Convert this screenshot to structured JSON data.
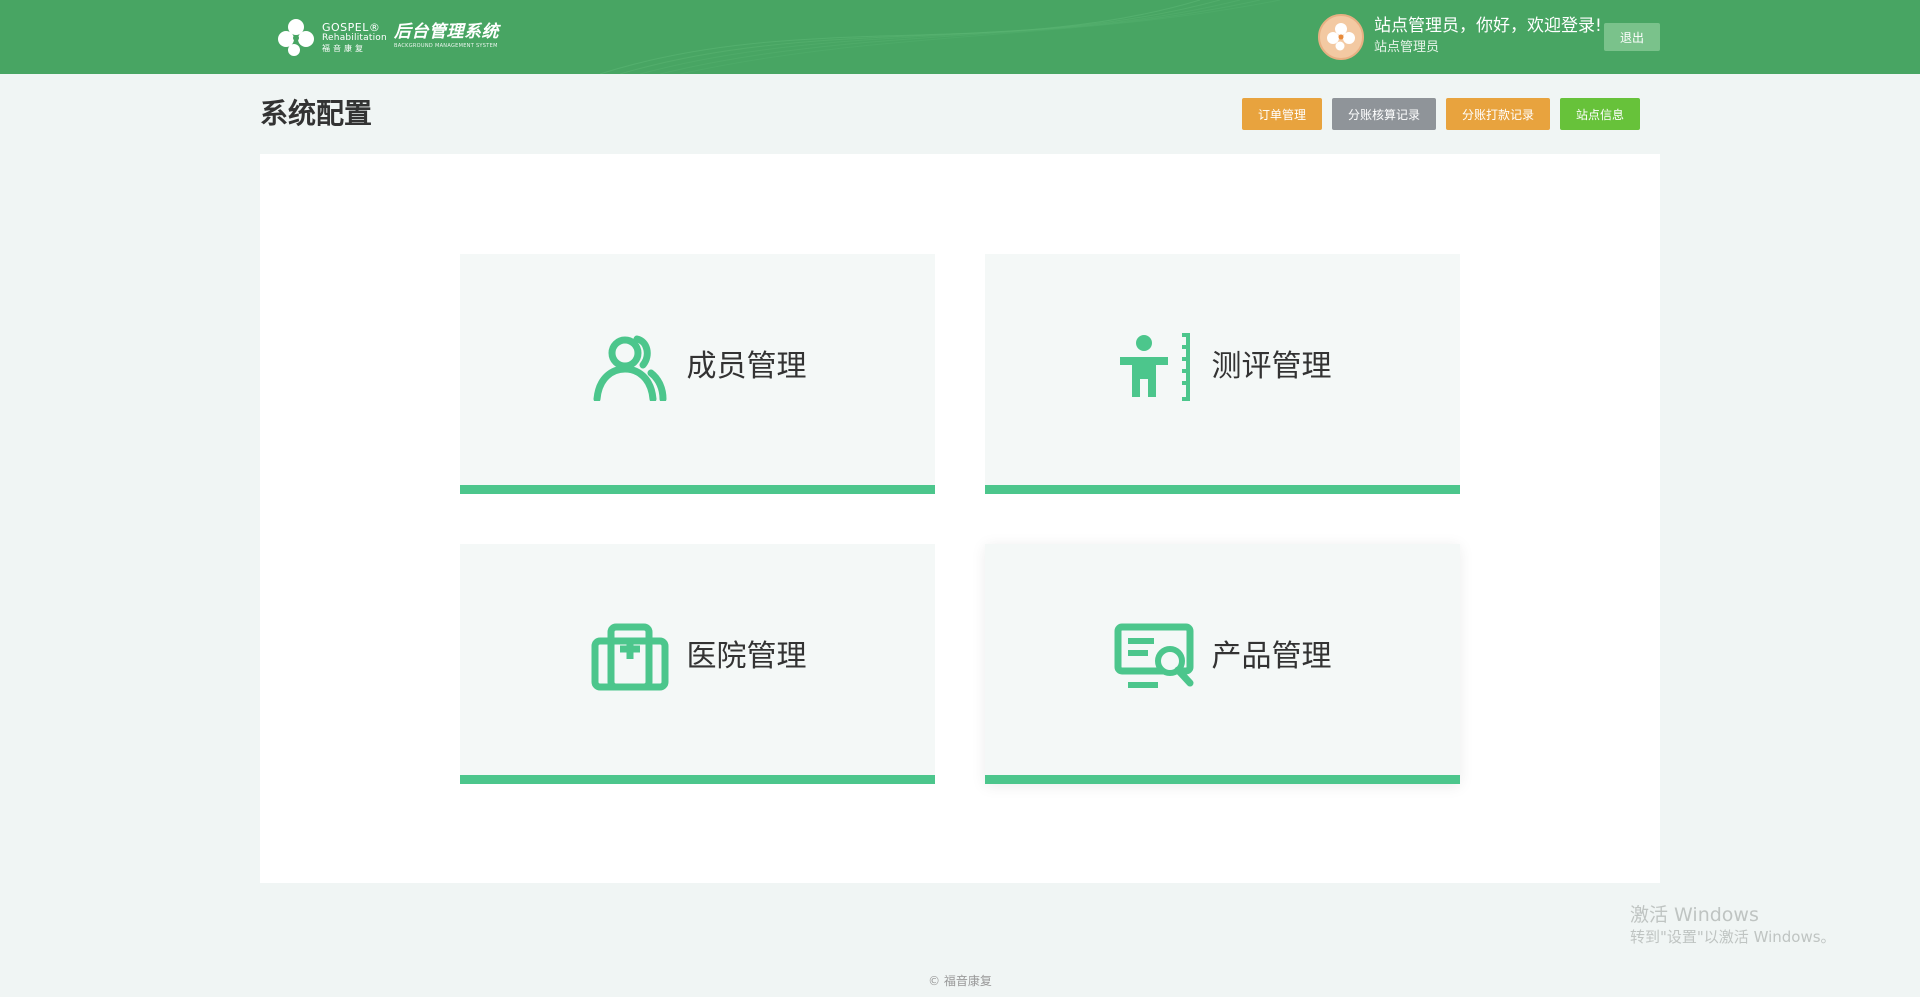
{
  "header": {
    "logo": {
      "en_line1": "GOSPEL®",
      "en_line2": "Rehabilitation",
      "cn_line": "福音康复"
    },
    "system_title": "后台管理系统",
    "system_title_en": "BACKGROUND MANAGEMENT SYSTEM",
    "user_greeting": "站点管理员，你好，欢迎登录!",
    "user_role": "站点管理员",
    "logout_label": "退出"
  },
  "page": {
    "title": "系统配置"
  },
  "actions": {
    "orders": "订单管理",
    "audit_records": "分账核算记录",
    "payout_records": "分账打款记录",
    "site_info": "站点信息"
  },
  "cards": [
    {
      "label": "成员管理",
      "icon": "members-icon"
    },
    {
      "label": "测评管理",
      "icon": "assessment-icon"
    },
    {
      "label": "医院管理",
      "icon": "hospital-icon"
    },
    {
      "label": "产品管理",
      "icon": "product-search-icon"
    }
  ],
  "footer": {
    "copyright": "© 福音康复"
  },
  "watermark": {
    "line1": "激活 Windows",
    "line2": "转到\"设置\"以激活 Windows。"
  },
  "colors": {
    "header_bg": "#48a563",
    "accent": "#4cc68c",
    "btn_orange": "#e8a33e",
    "btn_gray": "#8f9499",
    "btn_green": "#67c23a"
  }
}
